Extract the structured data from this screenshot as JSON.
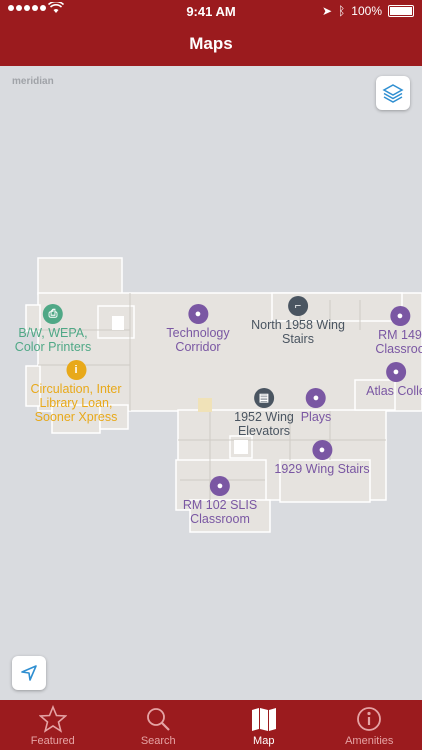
{
  "status_bar": {
    "time": "9:41 AM",
    "battery": "100%"
  },
  "header": {
    "title": "Maps"
  },
  "map": {
    "watermark": "meridian",
    "pois": [
      {
        "id": "bw-wepa",
        "label": [
          "B/W, WEPA,",
          "Color Printers"
        ],
        "color": "green"
      },
      {
        "id": "technology-corridor",
        "label": [
          "Technology",
          "Corridor"
        ],
        "color": "purple"
      },
      {
        "id": "north-1958-stairs",
        "label": [
          "North 1958 Wing",
          "Stairs"
        ],
        "color": "slate"
      },
      {
        "id": "rm-149",
        "label": [
          "RM 149",
          "Classroo"
        ],
        "color": "purple"
      },
      {
        "id": "circulation",
        "label": [
          "Circulation, Inter",
          "Library Loan,",
          "Sooner Xpress"
        ],
        "color": "yellow"
      },
      {
        "id": "atlas",
        "label": [
          "Atlas Colle"
        ],
        "color": "purple"
      },
      {
        "id": "plays",
        "label": [
          "Plays"
        ],
        "color": "purple"
      },
      {
        "id": "1952-elevators",
        "label": [
          "1952 Wing",
          "Elevators"
        ],
        "color": "slate"
      },
      {
        "id": "1929-stairs",
        "label": [
          "1929 Wing Stairs"
        ],
        "color": "purple"
      },
      {
        "id": "rm-102-slis",
        "label": [
          "RM 102 SLIS",
          "Classroom"
        ],
        "color": "purple"
      }
    ]
  },
  "tabs": [
    {
      "label": "Featured",
      "icon": "star-icon",
      "active": false
    },
    {
      "label": "Search",
      "icon": "search-icon",
      "active": false
    },
    {
      "label": "Map",
      "icon": "map-icon",
      "active": true
    },
    {
      "label": "Amenities",
      "icon": "info-icon",
      "active": false
    }
  ]
}
